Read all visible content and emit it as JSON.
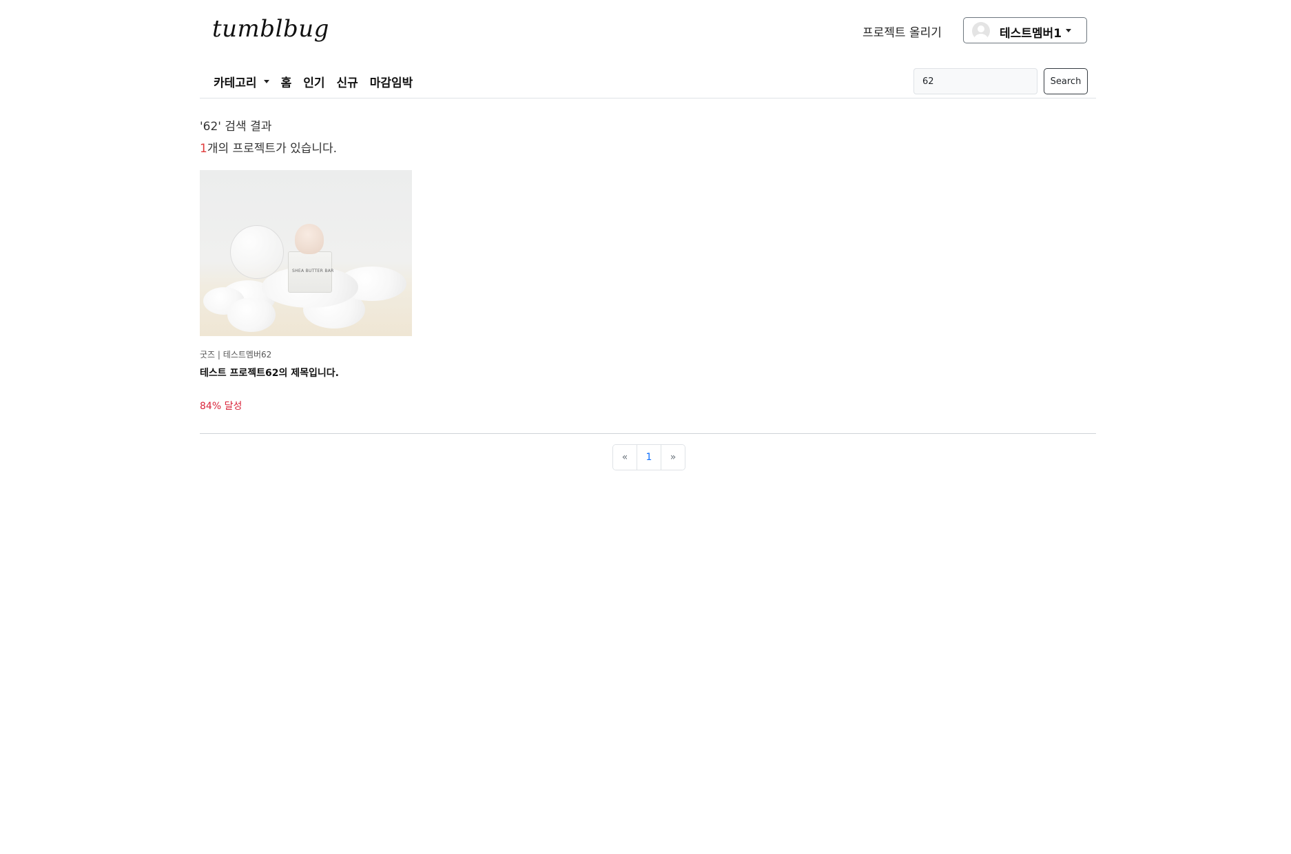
{
  "header": {
    "logo": "tumblbug",
    "upload_label": "프로젝트 올리기",
    "user_name": "테스트멤버1"
  },
  "nav": {
    "category_label": "카테고리",
    "items": [
      {
        "label": "홈"
      },
      {
        "label": "인기"
      },
      {
        "label": "신규"
      },
      {
        "label": "마감임박"
      }
    ]
  },
  "search": {
    "value": "62",
    "button_label": "Search"
  },
  "results": {
    "heading": "'62' 검색 결과",
    "count": "1",
    "count_suffix": "개의 프로젝트가 있습니다."
  },
  "projects": [
    {
      "category": "굿즈",
      "separator": "|",
      "creator": "테스트멤버62",
      "title": "테스트 프로젝트62의 제목입니다.",
      "achievement": "84% 달성",
      "image_label": "SHEA BUTTER BAR"
    }
  ],
  "pagination": {
    "prev": "«",
    "pages": [
      "1"
    ],
    "next": "»"
  },
  "colors": {
    "accent_red": "#d9243a",
    "count_red": "#e03a3a",
    "page_active": "#0d6efd"
  }
}
